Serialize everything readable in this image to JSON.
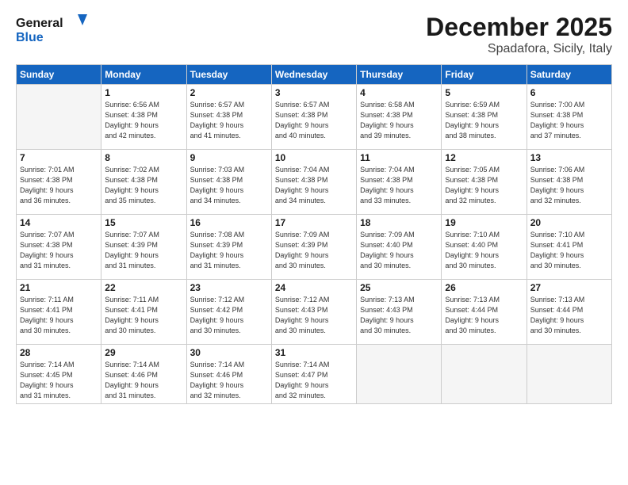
{
  "header": {
    "logo_general": "General",
    "logo_blue": "Blue",
    "month_year": "December 2025",
    "location": "Spadafora, Sicily, Italy"
  },
  "weekdays": [
    "Sunday",
    "Monday",
    "Tuesday",
    "Wednesday",
    "Thursday",
    "Friday",
    "Saturday"
  ],
  "weeks": [
    [
      {
        "day": "",
        "info": ""
      },
      {
        "day": "1",
        "info": "Sunrise: 6:56 AM\nSunset: 4:38 PM\nDaylight: 9 hours\nand 42 minutes."
      },
      {
        "day": "2",
        "info": "Sunrise: 6:57 AM\nSunset: 4:38 PM\nDaylight: 9 hours\nand 41 minutes."
      },
      {
        "day": "3",
        "info": "Sunrise: 6:57 AM\nSunset: 4:38 PM\nDaylight: 9 hours\nand 40 minutes."
      },
      {
        "day": "4",
        "info": "Sunrise: 6:58 AM\nSunset: 4:38 PM\nDaylight: 9 hours\nand 39 minutes."
      },
      {
        "day": "5",
        "info": "Sunrise: 6:59 AM\nSunset: 4:38 PM\nDaylight: 9 hours\nand 38 minutes."
      },
      {
        "day": "6",
        "info": "Sunrise: 7:00 AM\nSunset: 4:38 PM\nDaylight: 9 hours\nand 37 minutes."
      }
    ],
    [
      {
        "day": "7",
        "info": "Sunrise: 7:01 AM\nSunset: 4:38 PM\nDaylight: 9 hours\nand 36 minutes."
      },
      {
        "day": "8",
        "info": "Sunrise: 7:02 AM\nSunset: 4:38 PM\nDaylight: 9 hours\nand 35 minutes."
      },
      {
        "day": "9",
        "info": "Sunrise: 7:03 AM\nSunset: 4:38 PM\nDaylight: 9 hours\nand 34 minutes."
      },
      {
        "day": "10",
        "info": "Sunrise: 7:04 AM\nSunset: 4:38 PM\nDaylight: 9 hours\nand 34 minutes."
      },
      {
        "day": "11",
        "info": "Sunrise: 7:04 AM\nSunset: 4:38 PM\nDaylight: 9 hours\nand 33 minutes."
      },
      {
        "day": "12",
        "info": "Sunrise: 7:05 AM\nSunset: 4:38 PM\nDaylight: 9 hours\nand 32 minutes."
      },
      {
        "day": "13",
        "info": "Sunrise: 7:06 AM\nSunset: 4:38 PM\nDaylight: 9 hours\nand 32 minutes."
      }
    ],
    [
      {
        "day": "14",
        "info": "Sunrise: 7:07 AM\nSunset: 4:38 PM\nDaylight: 9 hours\nand 31 minutes."
      },
      {
        "day": "15",
        "info": "Sunrise: 7:07 AM\nSunset: 4:39 PM\nDaylight: 9 hours\nand 31 minutes."
      },
      {
        "day": "16",
        "info": "Sunrise: 7:08 AM\nSunset: 4:39 PM\nDaylight: 9 hours\nand 31 minutes."
      },
      {
        "day": "17",
        "info": "Sunrise: 7:09 AM\nSunset: 4:39 PM\nDaylight: 9 hours\nand 30 minutes."
      },
      {
        "day": "18",
        "info": "Sunrise: 7:09 AM\nSunset: 4:40 PM\nDaylight: 9 hours\nand 30 minutes."
      },
      {
        "day": "19",
        "info": "Sunrise: 7:10 AM\nSunset: 4:40 PM\nDaylight: 9 hours\nand 30 minutes."
      },
      {
        "day": "20",
        "info": "Sunrise: 7:10 AM\nSunset: 4:41 PM\nDaylight: 9 hours\nand 30 minutes."
      }
    ],
    [
      {
        "day": "21",
        "info": "Sunrise: 7:11 AM\nSunset: 4:41 PM\nDaylight: 9 hours\nand 30 minutes."
      },
      {
        "day": "22",
        "info": "Sunrise: 7:11 AM\nSunset: 4:41 PM\nDaylight: 9 hours\nand 30 minutes."
      },
      {
        "day": "23",
        "info": "Sunrise: 7:12 AM\nSunset: 4:42 PM\nDaylight: 9 hours\nand 30 minutes."
      },
      {
        "day": "24",
        "info": "Sunrise: 7:12 AM\nSunset: 4:43 PM\nDaylight: 9 hours\nand 30 minutes."
      },
      {
        "day": "25",
        "info": "Sunrise: 7:13 AM\nSunset: 4:43 PM\nDaylight: 9 hours\nand 30 minutes."
      },
      {
        "day": "26",
        "info": "Sunrise: 7:13 AM\nSunset: 4:44 PM\nDaylight: 9 hours\nand 30 minutes."
      },
      {
        "day": "27",
        "info": "Sunrise: 7:13 AM\nSunset: 4:44 PM\nDaylight: 9 hours\nand 30 minutes."
      }
    ],
    [
      {
        "day": "28",
        "info": "Sunrise: 7:14 AM\nSunset: 4:45 PM\nDaylight: 9 hours\nand 31 minutes."
      },
      {
        "day": "29",
        "info": "Sunrise: 7:14 AM\nSunset: 4:46 PM\nDaylight: 9 hours\nand 31 minutes."
      },
      {
        "day": "30",
        "info": "Sunrise: 7:14 AM\nSunset: 4:46 PM\nDaylight: 9 hours\nand 32 minutes."
      },
      {
        "day": "31",
        "info": "Sunrise: 7:14 AM\nSunset: 4:47 PM\nDaylight: 9 hours\nand 32 minutes."
      },
      {
        "day": "",
        "info": ""
      },
      {
        "day": "",
        "info": ""
      },
      {
        "day": "",
        "info": ""
      }
    ]
  ]
}
